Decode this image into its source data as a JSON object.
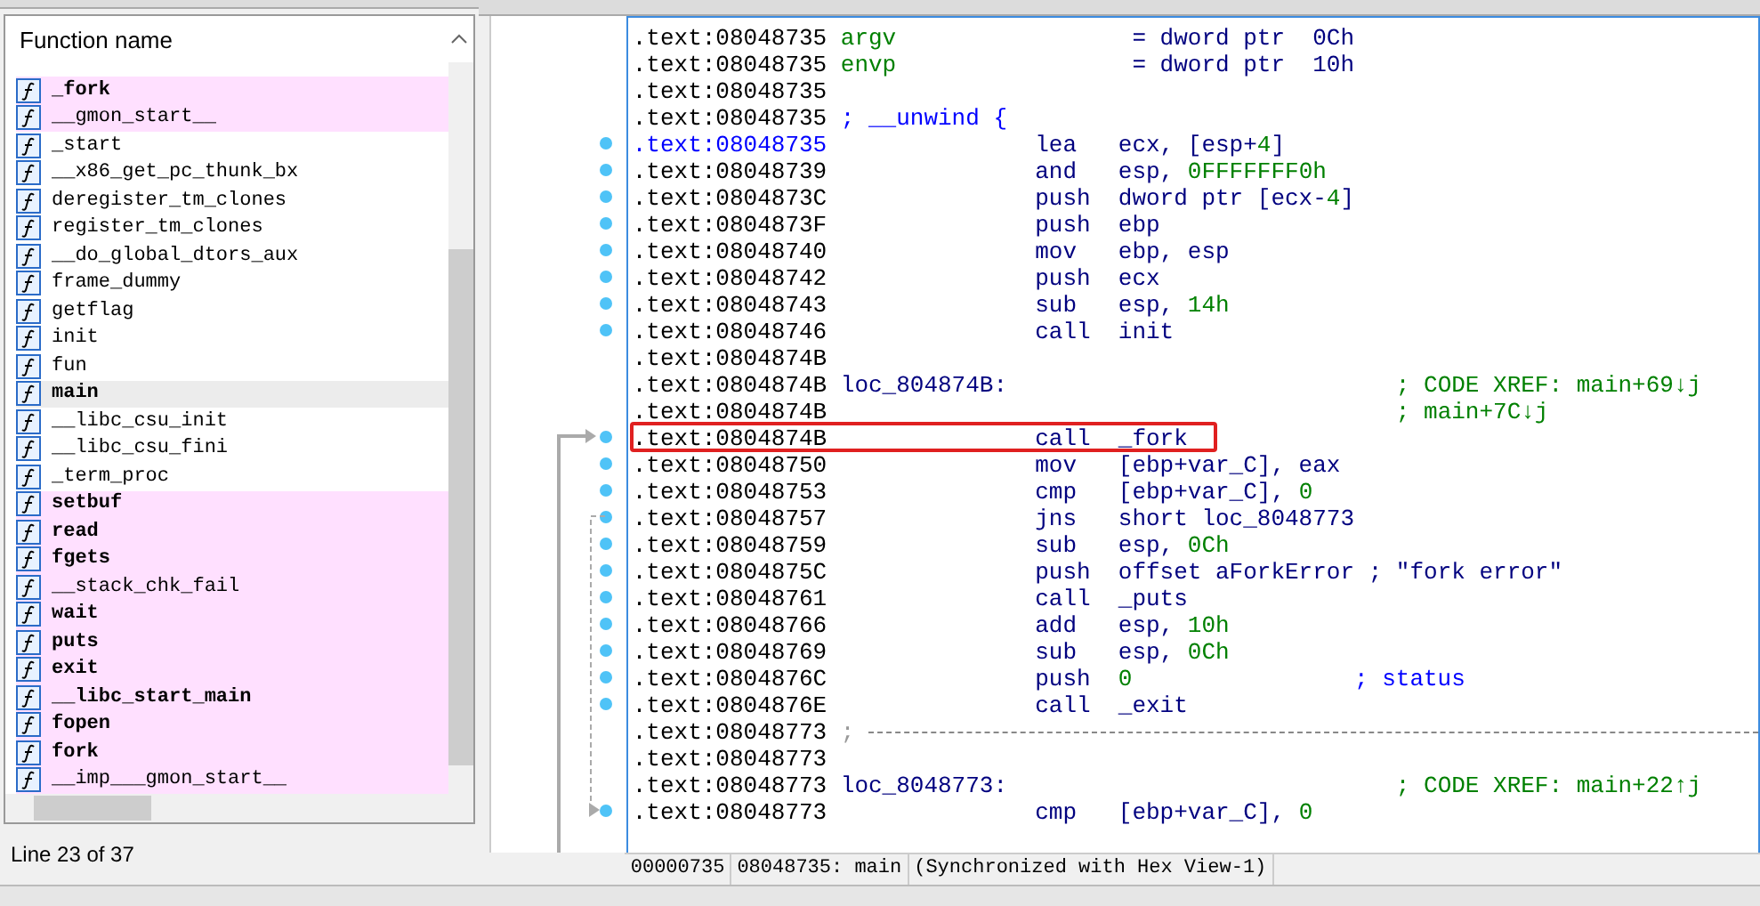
{
  "functions_panel": {
    "header": "Function name",
    "status": "Line 23 of 37",
    "functions": [
      {
        "name": "_fork",
        "bold": true,
        "imported": true,
        "selected": false
      },
      {
        "name": "__gmon_start__",
        "bold": false,
        "imported": true,
        "selected": false
      },
      {
        "name": "_start",
        "bold": false,
        "imported": false,
        "selected": false
      },
      {
        "name": "__x86_get_pc_thunk_bx",
        "bold": false,
        "imported": false,
        "selected": false
      },
      {
        "name": "deregister_tm_clones",
        "bold": false,
        "imported": false,
        "selected": false
      },
      {
        "name": "register_tm_clones",
        "bold": false,
        "imported": false,
        "selected": false
      },
      {
        "name": "__do_global_dtors_aux",
        "bold": false,
        "imported": false,
        "selected": false
      },
      {
        "name": "frame_dummy",
        "bold": false,
        "imported": false,
        "selected": false
      },
      {
        "name": "getflag",
        "bold": false,
        "imported": false,
        "selected": false
      },
      {
        "name": "init",
        "bold": false,
        "imported": false,
        "selected": false
      },
      {
        "name": "fun",
        "bold": false,
        "imported": false,
        "selected": false
      },
      {
        "name": "main",
        "bold": true,
        "imported": false,
        "selected": true
      },
      {
        "name": "__libc_csu_init",
        "bold": false,
        "imported": false,
        "selected": false
      },
      {
        "name": "__libc_csu_fini",
        "bold": false,
        "imported": false,
        "selected": false
      },
      {
        "name": "_term_proc",
        "bold": false,
        "imported": false,
        "selected": false
      },
      {
        "name": "setbuf",
        "bold": true,
        "imported": true,
        "selected": false
      },
      {
        "name": "read",
        "bold": true,
        "imported": true,
        "selected": false
      },
      {
        "name": "fgets",
        "bold": true,
        "imported": true,
        "selected": false
      },
      {
        "name": "__stack_chk_fail",
        "bold": false,
        "imported": true,
        "selected": false
      },
      {
        "name": "wait",
        "bold": true,
        "imported": true,
        "selected": false
      },
      {
        "name": "puts",
        "bold": true,
        "imported": true,
        "selected": false
      },
      {
        "name": "exit",
        "bold": true,
        "imported": true,
        "selected": false
      },
      {
        "name": "__libc_start_main",
        "bold": true,
        "imported": true,
        "selected": false
      },
      {
        "name": "fopen",
        "bold": true,
        "imported": true,
        "selected": false
      },
      {
        "name": "fork",
        "bold": true,
        "imported": true,
        "selected": false
      },
      {
        "name": "__imp___gmon_start__",
        "bold": false,
        "imported": true,
        "selected": false
      }
    ]
  },
  "disassembly": {
    "lines": [
      {
        "kind": "stackvar",
        "address": ".text:08048735",
        "label": "argv",
        "text": "= dword ptr  0Ch",
        "dot": false,
        "current": false
      },
      {
        "kind": "stackvar",
        "address": ".text:08048735",
        "label": "envp",
        "text": "= dword ptr  10h",
        "dot": false,
        "current": false
      },
      {
        "kind": "blank",
        "address": ".text:08048735",
        "dot": false,
        "current": false
      },
      {
        "kind": "comment",
        "address": ".text:08048735",
        "text": "; __unwind {",
        "dot": false,
        "current": false
      },
      {
        "kind": "insn",
        "address": ".text:08048735",
        "mnemonic": "lea",
        "operands": "ecx, [esp+4]",
        "dot": true,
        "current": true
      },
      {
        "kind": "insn",
        "address": ".text:08048739",
        "mnemonic": "and",
        "operands": "esp, 0FFFFFFF0h",
        "dot": true,
        "current": false
      },
      {
        "kind": "insn",
        "address": ".text:0804873C",
        "mnemonic": "push",
        "operands": "dword ptr [ecx-4]",
        "dot": true,
        "current": false
      },
      {
        "kind": "insn",
        "address": ".text:0804873F",
        "mnemonic": "push",
        "operands": "ebp",
        "dot": true,
        "current": false
      },
      {
        "kind": "insn",
        "address": ".text:08048740",
        "mnemonic": "mov",
        "operands": "ebp, esp",
        "dot": true,
        "current": false
      },
      {
        "kind": "insn",
        "address": ".text:08048742",
        "mnemonic": "push",
        "operands": "ecx",
        "dot": true,
        "current": false
      },
      {
        "kind": "insn",
        "address": ".text:08048743",
        "mnemonic": "sub",
        "operands": "esp, 14h",
        "dot": true,
        "current": false
      },
      {
        "kind": "insn",
        "address": ".text:08048746",
        "mnemonic": "call",
        "operands": "init",
        "dot": true,
        "current": false
      },
      {
        "kind": "blank",
        "address": ".text:0804874B",
        "dot": false,
        "current": false
      },
      {
        "kind": "label",
        "address": ".text:0804874B",
        "label": "loc_804874B:",
        "comment": "; CODE XREF: main+69↓j",
        "dot": false,
        "current": false
      },
      {
        "kind": "label",
        "address": ".text:0804874B",
        "comment": "; main+7C↓j",
        "dot": false,
        "current": false
      },
      {
        "kind": "insn",
        "address": ".text:0804874B",
        "mnemonic": "call",
        "operands": "_fork",
        "dot": true,
        "current": false,
        "boxed": true
      },
      {
        "kind": "insn",
        "address": ".text:08048750",
        "mnemonic": "mov",
        "operands": "[ebp+var_C], eax",
        "dot": true,
        "current": false
      },
      {
        "kind": "insn",
        "address": ".text:08048753",
        "mnemonic": "cmp",
        "operands": "[ebp+var_C], 0",
        "dot": true,
        "current": false
      },
      {
        "kind": "insn",
        "address": ".text:08048757",
        "mnemonic": "jns",
        "operands": "short loc_8048773",
        "dot": true,
        "current": false
      },
      {
        "kind": "insn",
        "address": ".text:08048759",
        "mnemonic": "sub",
        "operands": "esp, 0Ch",
        "dot": true,
        "current": false
      },
      {
        "kind": "insn",
        "address": ".text:0804875C",
        "mnemonic": "push",
        "operands": "offset aForkError",
        "comment": "; \"fork error\"",
        "dot": true,
        "current": false
      },
      {
        "kind": "insn",
        "address": ".text:08048761",
        "mnemonic": "call",
        "operands": "_puts",
        "dot": true,
        "current": false
      },
      {
        "kind": "insn",
        "address": ".text:08048766",
        "mnemonic": "add",
        "operands": "esp, 10h",
        "dot": true,
        "current": false
      },
      {
        "kind": "insn",
        "address": ".text:08048769",
        "mnemonic": "sub",
        "operands": "esp, 0Ch",
        "dot": true,
        "current": false
      },
      {
        "kind": "insn",
        "address": ".text:0804876C",
        "mnemonic": "push",
        "operands": "0",
        "comment": "; status",
        "dot": true,
        "current": false
      },
      {
        "kind": "insn",
        "address": ".text:0804876E",
        "mnemonic": "call",
        "operands": "_exit",
        "dot": true,
        "current": false
      },
      {
        "kind": "separator",
        "address": ".text:08048773",
        "text": ";",
        "dot": false,
        "current": false
      },
      {
        "kind": "blank",
        "address": ".text:08048773",
        "dot": false,
        "current": false
      },
      {
        "kind": "label",
        "address": ".text:08048773",
        "label": "loc_8048773:",
        "comment": "; CODE XREF: main+22↑j",
        "dot": false,
        "current": false
      },
      {
        "kind": "insn",
        "address": ".text:08048773",
        "mnemonic": "cmp",
        "operands": "[ebp+var_C], 0",
        "dot": true,
        "current": false
      }
    ],
    "status": [
      "00000735",
      "08048735: main",
      "(Synchronized with Hex View-1)"
    ]
  }
}
